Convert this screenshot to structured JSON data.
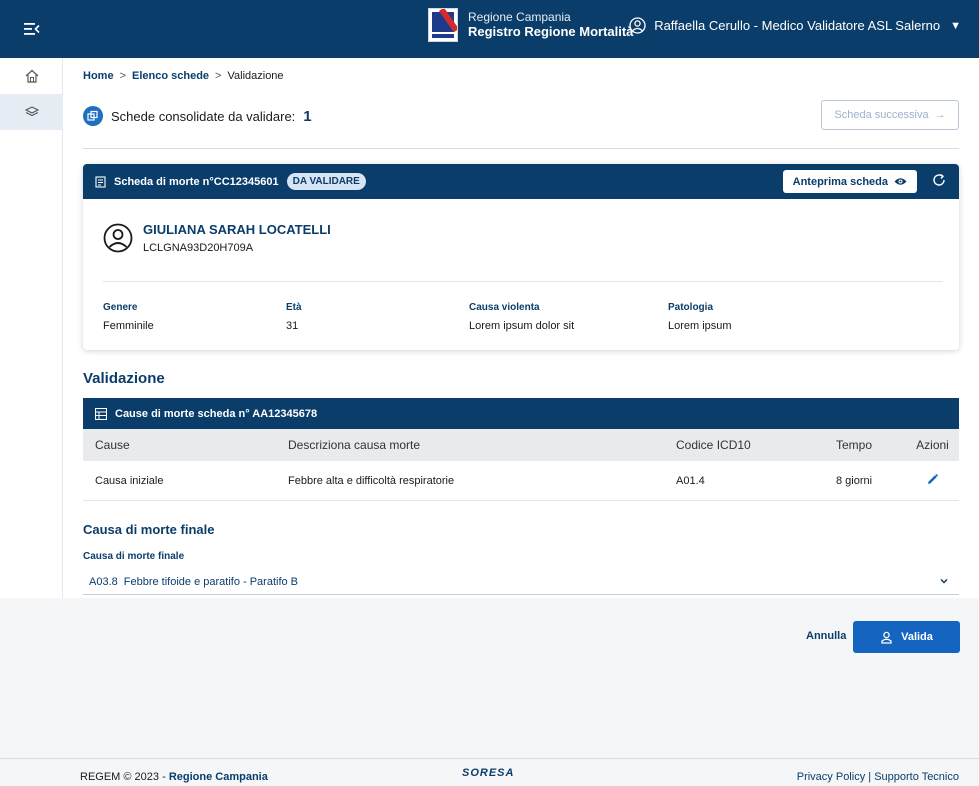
{
  "header": {
    "brand_line1": "Regione Campania",
    "brand_line2": "Registro Regione Mortalità",
    "user_label": "Raffaella Cerullo - Medico Validatore ASL Salerno",
    "bg_color": "#0b3d6b"
  },
  "breadcrumb": {
    "home": "Home",
    "sep1": ">",
    "list": "Elenco schede",
    "sep2": ">",
    "current": "Validazione"
  },
  "summary": {
    "label": "Schede consolidate da validare:",
    "count": "1",
    "next_label": "Scheda successiva"
  },
  "card": {
    "title": "Scheda di morte n°CC12345601",
    "badge": "DA VALIDARE",
    "preview_label": "Anteprima scheda",
    "person_name": "GIULIANA SARAH LOCATELLI",
    "fiscal_code": "LCLGNA93D20H709A",
    "fields": [
      {
        "label": "Genere",
        "value": "Femminile"
      },
      {
        "label": "Età",
        "value": "31"
      },
      {
        "label": "Causa violenta",
        "value": "Lorem ipsum dolor sit"
      },
      {
        "label": "Patologia",
        "value": "Lorem ipsum"
      }
    ]
  },
  "validation": {
    "title": "Validazione",
    "table_title": "Cause di morte scheda n° AA12345678",
    "columns": [
      "Cause",
      "Descriziona causa morte",
      "Codice ICD10",
      "Tempo",
      "Azioni"
    ],
    "rows": [
      {
        "cause": "Causa iniziale",
        "description": "Febbre alta e difficoltà respiratorie",
        "icd10": "A01.4",
        "time": "8 giorni"
      }
    ],
    "final_title": "Causa di morte finale",
    "final_label": "Causa di morte finale",
    "final_code": "A03.8",
    "final_value": "Febbre tifoide e paratifo - Paratifo B"
  },
  "actions": {
    "cancel": "Annulla",
    "confirm": "Valida",
    "confirm_color": "#1565c0"
  },
  "footer": {
    "copyright": "REGEM © 2023 - ",
    "owner": "Regione Campania",
    "logo": "SORESA",
    "privacy": "Privacy Policy",
    "sep": "|",
    "support": "Supporto Tecnico"
  }
}
